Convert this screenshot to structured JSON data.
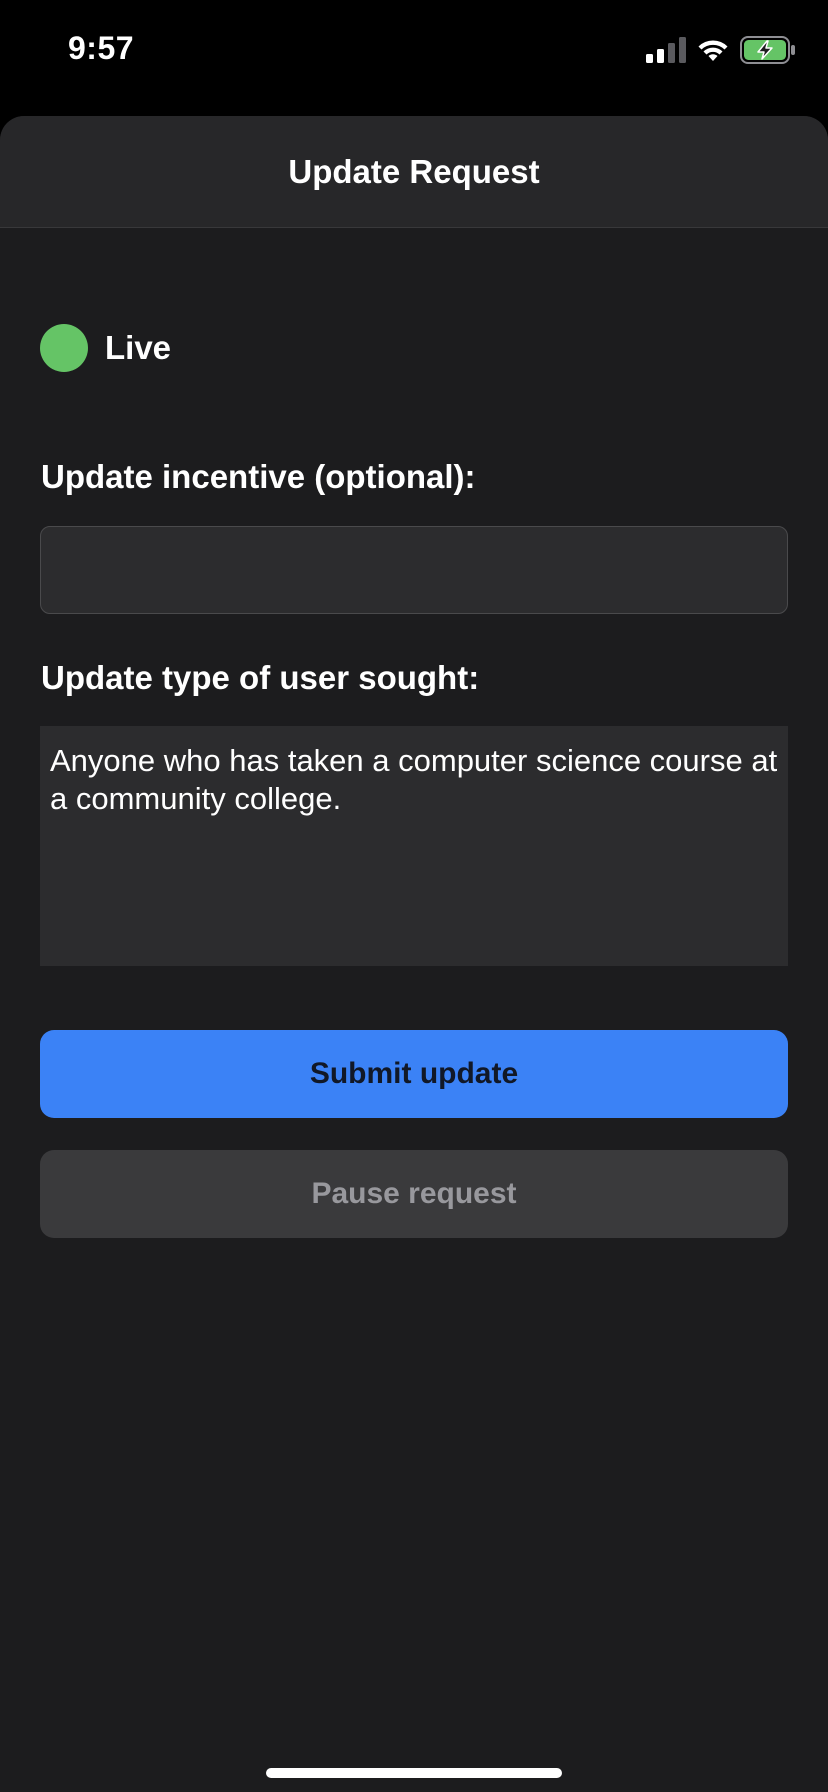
{
  "status_bar": {
    "time": "9:57",
    "icons": [
      "cellular-signal-icon",
      "wifi-icon",
      "battery-charging-icon"
    ]
  },
  "header": {
    "title": "Update Request"
  },
  "status": {
    "label": "Live",
    "color": "#65c466"
  },
  "form": {
    "incentive_label": "Update incentive (optional):",
    "incentive_value": "",
    "user_label": "Update type of user sought:",
    "user_value": "Anyone who has taken a computer science course at a community college."
  },
  "actions": {
    "submit_label": "Submit update",
    "submit_color": "#3b82f6",
    "pause_label": "Pause request"
  }
}
